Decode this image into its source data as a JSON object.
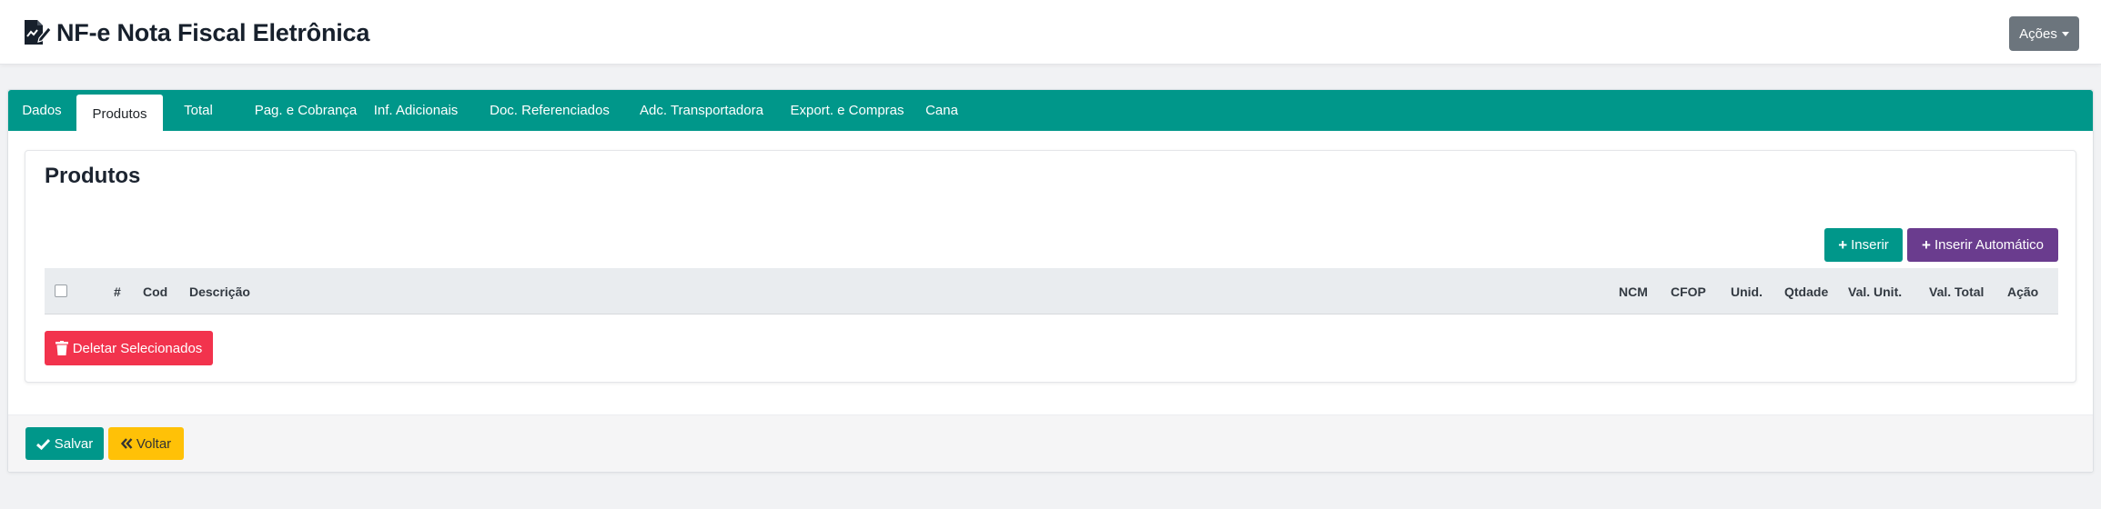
{
  "header": {
    "title": "NF-e Nota Fiscal Eletrônica",
    "icon": "document-edit-icon",
    "actions_label": "Ações"
  },
  "tabs": [
    {
      "label": "Dados",
      "active": false
    },
    {
      "label": "Produtos",
      "active": true
    },
    {
      "label": "Total",
      "active": false
    },
    {
      "label": "Pag. e Cobrança",
      "active": false
    },
    {
      "label": "Inf. Adicionais",
      "active": false
    },
    {
      "label": "Doc. Referenciados",
      "active": false
    },
    {
      "label": "Adc. Transportadora",
      "active": false
    },
    {
      "label": "Export. e Compras",
      "active": false
    },
    {
      "label": "Cana",
      "active": false
    }
  ],
  "produtos": {
    "title": "Produtos",
    "insert_label": "Inserir",
    "insert_auto_label": "Inserir Automático",
    "delete_selected_label": "Deletar Selecionados",
    "columns": [
      "#",
      "Cod",
      "Descrição",
      "NCM",
      "CFOP",
      "Unid.",
      "Qtdade",
      "Val. Unit.",
      "Val. Total",
      "Ação"
    ]
  },
  "footer": {
    "save_label": "Salvar",
    "back_label": "Voltar"
  },
  "colors": {
    "primary": "#00978a",
    "purple": "#6a3c8e",
    "danger": "#f2334d",
    "warning": "#ffc107",
    "secondary": "#6c757d"
  }
}
